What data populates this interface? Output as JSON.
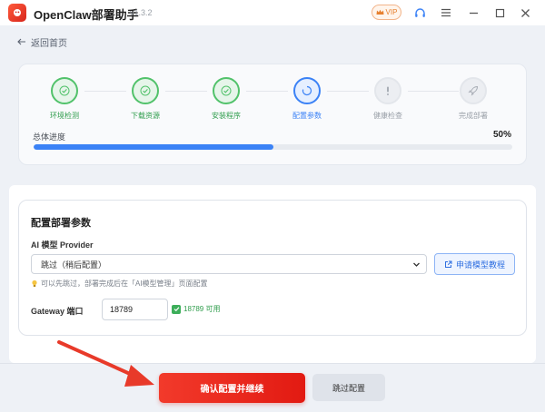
{
  "window": {
    "title": "OpenClaw部署助手",
    "version": "v1.3.2",
    "vip_label": "VIP"
  },
  "nav": {
    "back_label": "返回首页"
  },
  "steps": [
    {
      "label": "环境检测",
      "status": "done",
      "icon": "check-icon"
    },
    {
      "label": "下载资源",
      "status": "done",
      "icon": "check-icon"
    },
    {
      "label": "安装程序",
      "status": "done",
      "icon": "check-icon"
    },
    {
      "label": "配置参数",
      "status": "active",
      "icon": "spinner-icon"
    },
    {
      "label": "健康检查",
      "status": "pending",
      "icon": "exclamation-icon"
    },
    {
      "label": "完成部署",
      "status": "pending",
      "icon": "rocket-icon"
    }
  ],
  "progress": {
    "label": "总体进度",
    "percent_text": "50%",
    "value": 0.5
  },
  "config": {
    "title": "配置部署参数",
    "provider_label": "AI 模型 Provider",
    "provider_selected": "跳过（稍后配置）",
    "tutorial_label": "申请模型教程",
    "hint": "可以先跳过，部署完成后在「AI模型管理」页面配置",
    "gateway_label": "Gateway 端口",
    "gateway_port": "18789",
    "port_status": "18789 可用"
  },
  "footer": {
    "confirm_label": "确认配置并继续",
    "skip_label": "跳过配置"
  },
  "colors": {
    "accent": "#3b82f6",
    "success": "#52c26b",
    "brand_red": "#e21a12"
  }
}
